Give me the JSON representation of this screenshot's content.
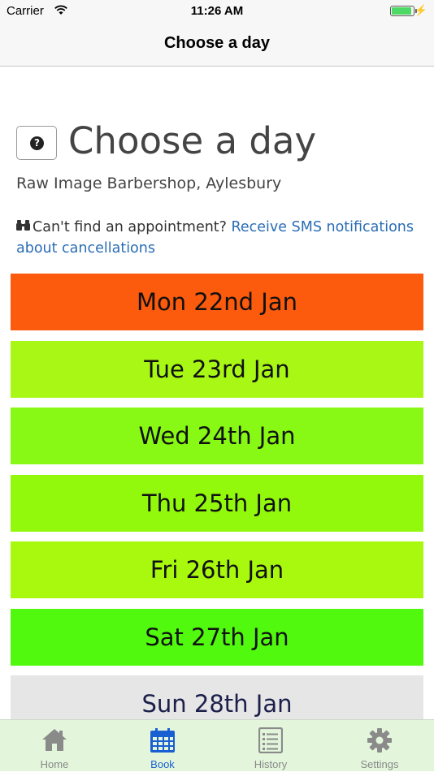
{
  "status_bar": {
    "carrier": "Carrier",
    "time": "11:26 AM"
  },
  "nav": {
    "title": "Choose a day"
  },
  "header": {
    "title": "Choose a day",
    "shop": "Raw Image Barbershop, Aylesbury",
    "notice_text": "Can't find an appointment?",
    "notice_link": "Receive SMS notifications about cancellations"
  },
  "days": [
    {
      "label": "Mon 22nd Jan",
      "color": "#fc5a0d"
    },
    {
      "label": "Tue 23rd Jan",
      "color": "#a8f714"
    },
    {
      "label": "Wed 24th Jan",
      "color": "#88f914"
    },
    {
      "label": "Thu 25th Jan",
      "color": "#92f90c"
    },
    {
      "label": "Fri 26th Jan",
      "color": "#a8f90e"
    },
    {
      "label": "Sat 27th Jan",
      "color": "#51f90e"
    },
    {
      "label": "Sun 28th Jan",
      "color": "#e6e6e6"
    }
  ],
  "tabs": [
    {
      "label": "Home",
      "icon": "home-icon",
      "active": false
    },
    {
      "label": "Book",
      "icon": "calendar-icon",
      "active": true
    },
    {
      "label": "History",
      "icon": "list-icon",
      "active": false
    },
    {
      "label": "Settings",
      "icon": "gear-icon",
      "active": false
    }
  ],
  "colors": {
    "accent": "#1a5fd1",
    "link": "#2a6db5",
    "tab_bar": "#e3f6dc"
  }
}
